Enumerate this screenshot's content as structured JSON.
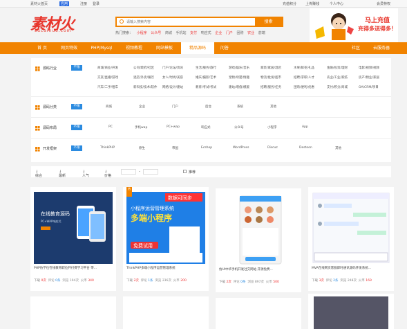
{
  "topbar": {
    "home": "素材火首页",
    "app": "应用",
    "register": "注册",
    "login": "登录",
    "top_up": "充值积分",
    "upload": "上传赚钱",
    "personal": "个人中心",
    "vip": "会员特权"
  },
  "logo": {
    "text": "素材火",
    "sub": "sucaihuo.com"
  },
  "search": {
    "placeholder": "请输入搜索内容",
    "button": "搜索"
  },
  "hot": {
    "label": "热门搜索：",
    "items": [
      "小程序",
      "公众号",
      "商城",
      "手机站",
      "支付",
      "响应式",
      "企业",
      "门户",
      "团购",
      "农业",
      "前端"
    ]
  },
  "banner": {
    "line1": "马上充值",
    "line2": "充得多送得多！"
  },
  "nav": {
    "items": [
      "首 页",
      "网页特效",
      "PHP/Mysql",
      "视频教程",
      "网站模板",
      "精品源码",
      "问答"
    ],
    "community": "社区",
    "cloud": "云服务器"
  },
  "filter": {
    "rows": [
      {
        "label": "源码行业",
        "all": "不限",
        "items": [
          "商城/商业/开发",
          "公司/政府/社区",
          "门户/论坛/资讯",
          "生活/服务/旅行",
          "游戏/娱乐/音乐",
          "家装/家居/酒店",
          "水果/鲜花/礼品",
          "金融/投资/理财",
          "电影/视频/视频",
          "交友/直播/游戏",
          "酒店/外卖/餐饮",
          "女人/时尚/美容",
          "婚庆/摄影/艺术",
          "宠物/母婴/情趣",
          "物流/批发/超市",
          "招聘/求职/人才",
          "农业/工业/家纺",
          "房产/物业/家居",
          "汽车/二手/租车",
          "新科技/技术/软件",
          "网络/设计/建站",
          "教育/考试/考试",
          "建站/增值/模版",
          "招聘/服务/任务",
          "团购/便利/优惠",
          "支付/积分/商城",
          "OA/CRM/项目",
          "API/数据/演示"
        ]
      },
      {
        "label": "源码分类",
        "all": "不限",
        "items": [
          "商城",
          "企业",
          "门户",
          "后台",
          "系统",
          "其他"
        ]
      },
      {
        "label": "源码布局",
        "all": "不限",
        "items": [
          "PC",
          "手机wap",
          "PC+wap",
          "响应式",
          "公众号",
          "小程序",
          "App"
        ]
      },
      {
        "label": "开发框架",
        "all": "不限",
        "items": [
          "ThinkPHP",
          "原生",
          "帝国",
          "Ecshop",
          "WordPress",
          "Discuz",
          "Destoon",
          "其他"
        ]
      }
    ]
  },
  "sort": {
    "composite": "综合",
    "latest": "最新",
    "popular": "人气",
    "price": "价格",
    "dash": "-",
    "free": "推荐"
  },
  "cards": [
    {
      "title": "PHP仿学位在线教育职位开付费学习平台 带...",
      "down_label": "下载",
      "down": "0次",
      "comment_label": "评论",
      "comment": "0条",
      "views_label": "浏览",
      "views": "194次",
      "fire_label": "火币",
      "fire": "340",
      "img_text": "在线教育源码",
      "img_sub": "PC+WAP响应式"
    },
    {
      "title": "ThinkPHP多端小程序运营管理系统",
      "down_label": "下载",
      "down": "2次",
      "comment_label": "评论",
      "comment": "1条",
      "views_label": "浏览",
      "views": "236次",
      "fire_label": "火币",
      "fire": "200",
      "img_top": "数据可同步",
      "img_l1": "小程序运营管理系统",
      "img_l2": "多端小程序",
      "img_btn": "免费试用"
    },
    {
      "title": "仿UI中华手机开发社交网站 开源免费...",
      "down_label": "下载",
      "down": "2次",
      "comment_label": "评论",
      "comment": "0条",
      "views_label": "浏览",
      "views": "897次",
      "fire_label": "火币",
      "fire": "500"
    },
    {
      "title": "MVA在线网页客服即时通讯源码开发系统...",
      "down_label": "下载",
      "down": "3次",
      "comment_label": "评论",
      "comment": "2条",
      "views_label": "浏览",
      "views": "248次",
      "fire_label": "火币",
      "fire": "169"
    }
  ],
  "colors": {
    "brand": "#f18300",
    "logo": "#e8362c",
    "all_btn": "#2b8be0"
  }
}
